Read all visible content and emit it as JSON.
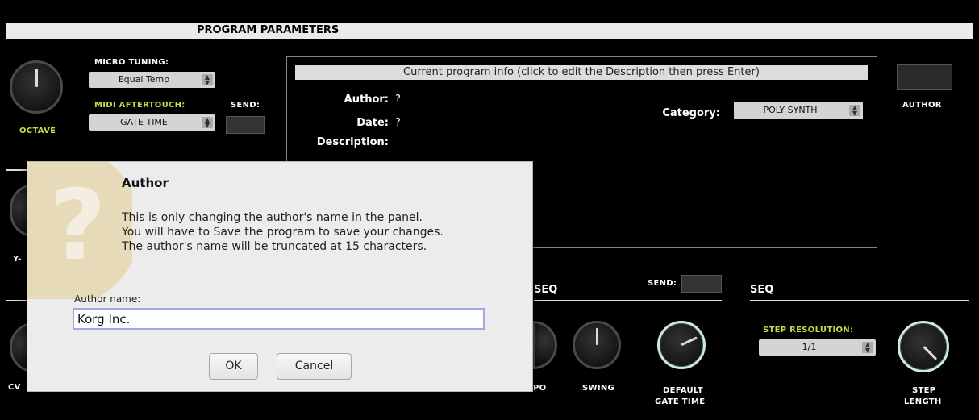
{
  "header": {
    "title": "PROGRAM PARAMETERS"
  },
  "left": {
    "octave_label": "OCTAVE",
    "micro_tuning_label": "MICRO TUNING:",
    "micro_tuning_value": "Equal Temp",
    "midi_aftertouch_label": "MIDI AFTERTOUCH:",
    "midi_aftertouch_value": "GATE TIME",
    "send_label": "SEND:",
    "y_label": "Y-",
    "cv_label": "CV"
  },
  "info": {
    "title": "Current program info (click to edit the Description then press Enter)",
    "author_label": "Author:",
    "author_value": "?",
    "date_label": "Date:",
    "date_value": "?",
    "description_label": "Description:",
    "category_label": "Category:",
    "category_value": "POLY SYNTH"
  },
  "right": {
    "author_button_label": "AUTHOR"
  },
  "sections": [
    {
      "title": "SEQ",
      "send_label": "SEND:"
    },
    {
      "title": "SEQ"
    }
  ],
  "seq": {
    "tempo_label": "PO",
    "swing_label": "SWING",
    "default_gate_label_1": "DEFAULT",
    "default_gate_label_2": "GATE TIME",
    "step_resolution_label": "STEP RESOLUTION:",
    "step_resolution_value": "1/1",
    "step_length_label_1": "STEP",
    "step_length_label_2": "LENGTH"
  },
  "dialog": {
    "title": "Author",
    "message": [
      "This is only changing the author's name in the panel.",
      "You will have to Save the program to save your changes.",
      "The author's name will be truncated at 15 characters."
    ],
    "field_label": "Author name:",
    "field_value": "Korg Inc.",
    "ok_label": "OK",
    "cancel_label": "Cancel"
  },
  "colors": {
    "accent_label": "#c8d84a",
    "background": "#000000",
    "dialog_bg": "#ececec",
    "input_focus": "#9fa8e8"
  }
}
